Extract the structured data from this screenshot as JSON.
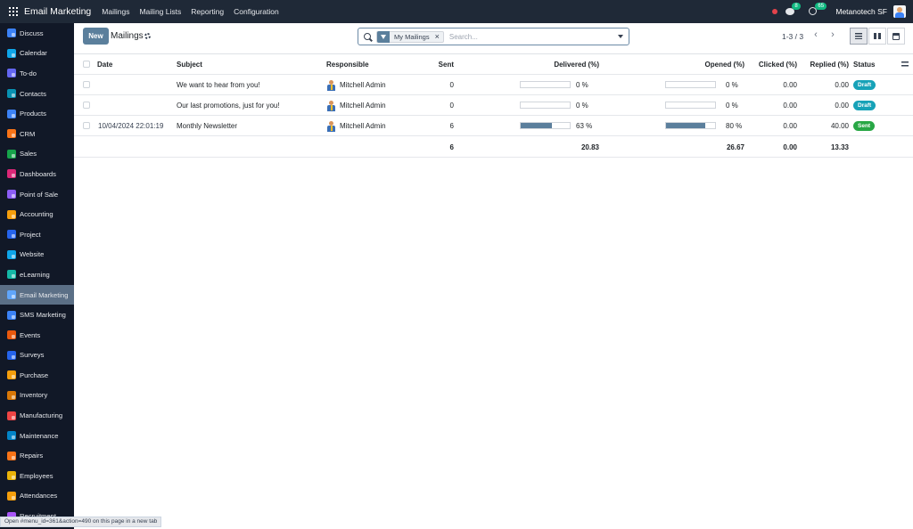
{
  "topbar": {
    "app_title": "Email Marketing",
    "menus": [
      "Mailings",
      "Mailing Lists",
      "Reporting",
      "Configuration"
    ],
    "chat_count": "8",
    "activity_count": "65",
    "company": "Metanotech SF",
    "icons": [
      "apps-icon",
      "status-dot-icon",
      "chat-icon",
      "activity-clock-icon",
      "user-avatar-icon"
    ]
  },
  "sidebar": {
    "items": [
      {
        "label": "Discuss",
        "color": "#3b82f6"
      },
      {
        "label": "Calendar",
        "color": "#0ea5e9"
      },
      {
        "label": "To-do",
        "color": "#6366f1"
      },
      {
        "label": "Contacts",
        "color": "#0891b2"
      },
      {
        "label": "Products",
        "color": "#3b82f6"
      },
      {
        "label": "CRM",
        "color": "#f97316"
      },
      {
        "label": "Sales",
        "color": "#16a34a"
      },
      {
        "label": "Dashboards",
        "color": "#db2777"
      },
      {
        "label": "Point of Sale",
        "color": "#8b5cf6"
      },
      {
        "label": "Accounting",
        "color": "#f59e0b"
      },
      {
        "label": "Project",
        "color": "#2563eb"
      },
      {
        "label": "Website",
        "color": "#0ea5e9"
      },
      {
        "label": "eLearning",
        "color": "#14b8a6"
      },
      {
        "label": "Email Marketing",
        "color": "#60a5fa"
      },
      {
        "label": "SMS Marketing",
        "color": "#3b82f6"
      },
      {
        "label": "Events",
        "color": "#ea580c"
      },
      {
        "label": "Surveys",
        "color": "#2563eb"
      },
      {
        "label": "Purchase",
        "color": "#f59e0b"
      },
      {
        "label": "Inventory",
        "color": "#d97706"
      },
      {
        "label": "Manufacturing",
        "color": "#ef4444"
      },
      {
        "label": "Maintenance",
        "color": "#0284c7"
      },
      {
        "label": "Repairs",
        "color": "#f97316"
      },
      {
        "label": "Employees",
        "color": "#eab308"
      },
      {
        "label": "Attendances",
        "color": "#f59e0b"
      },
      {
        "label": "Recruitment",
        "color": "#a855f7"
      }
    ],
    "active": "Email Marketing"
  },
  "control": {
    "new_label": "New",
    "breadcrumb": "Mailings",
    "facet_label": "My Mailings",
    "facet_remove": "×",
    "search_placeholder": "Search...",
    "pager": "1-3 / 3",
    "views": [
      "list-view",
      "kanban-view",
      "calendar-view"
    ],
    "active_view": "list-view"
  },
  "table": {
    "headers": {
      "date": "Date",
      "subject": "Subject",
      "responsible": "Responsible",
      "sent": "Sent",
      "delivered": "Delivered (%)",
      "opened": "Opened (%)",
      "clicked": "Clicked (%)",
      "replied": "Replied (%)",
      "status": "Status"
    },
    "rows": [
      {
        "date": "",
        "subject": "We want to hear from you!",
        "responsible": "Mitchell Admin",
        "sent": "0",
        "delivered_text": "0 %",
        "delivered": 0,
        "opened_text": "0 %",
        "opened": 0,
        "clicked": "0.00",
        "replied": "0.00",
        "status": "Draft",
        "status_color": "#17a2b8"
      },
      {
        "date": "",
        "subject": "Our last promotions, just for you!",
        "responsible": "Mitchell Admin",
        "sent": "0",
        "delivered_text": "0 %",
        "delivered": 0,
        "opened_text": "0 %",
        "opened": 0,
        "clicked": "0.00",
        "replied": "0.00",
        "status": "Draft",
        "status_color": "#17a2b8"
      },
      {
        "date": "10/04/2024 22:01:19",
        "subject": "Monthly Newsletter",
        "responsible": "Mitchell Admin",
        "sent": "6",
        "delivered_text": "63 %",
        "delivered": 63,
        "opened_text": "80 %",
        "opened": 80,
        "clicked": "0.00",
        "replied": "40.00",
        "status": "Sent",
        "status_color": "#28a745"
      }
    ],
    "totals": {
      "sent": "6",
      "delivered": "20.83",
      "opened": "26.67",
      "clicked": "0.00",
      "replied": "13.33"
    }
  },
  "statusbar": {
    "text": "Open #menu_id=361&action=490 on this page in a new tab"
  }
}
